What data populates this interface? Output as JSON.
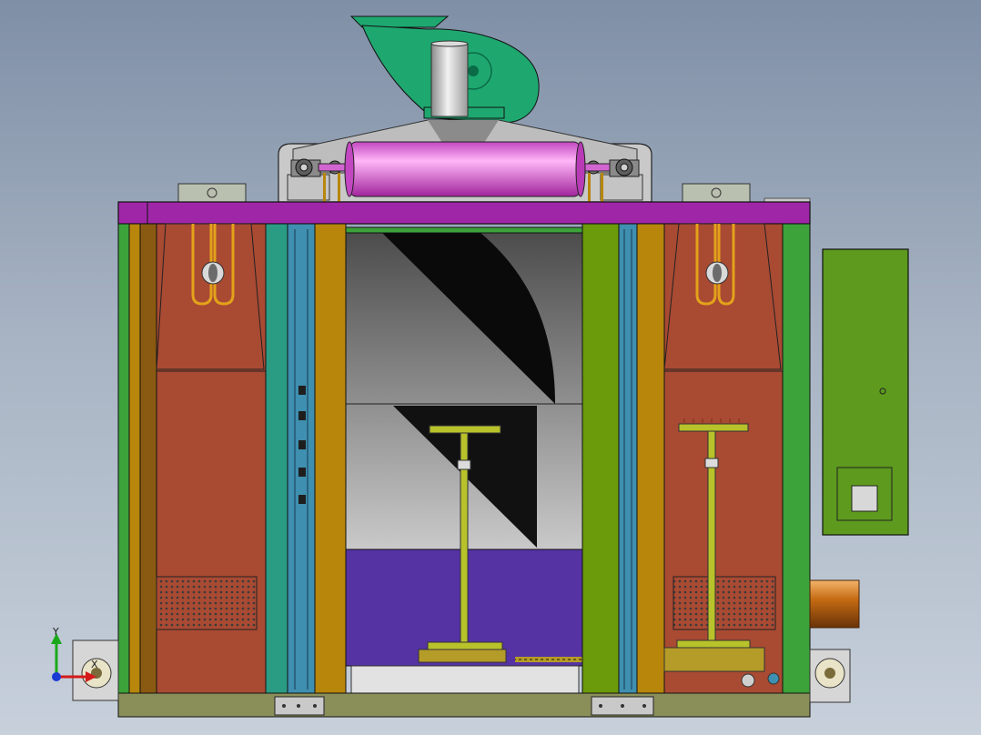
{
  "viewport": {
    "background_top": "#7f8fa6",
    "background_bottom": "#c7d0db"
  },
  "colors": {
    "frame_magenta": "#a026a8",
    "post_green": "#3ca23a",
    "post_olive": "#6b9a0a",
    "post_gold": "#b8860b",
    "panel_rust": "#a94a33",
    "teal_strip": "#2a9c84",
    "blue_strip": "#3f8fb0",
    "fan_green": "#1ea870",
    "roller_pink": "#e26ee0",
    "floor_purple": "#5533a3",
    "control_box": "#5d9a1e",
    "exhaust_copper": "#c56b14",
    "stand_yellow": "#b8c22a",
    "chamber_gray": "#a9a9a9"
  },
  "triad": {
    "y_label": "Y",
    "x_label": "X"
  },
  "icons": [
    "fan-icon",
    "bearing-icon",
    "heater-coil-icon",
    "vent-grille-icon",
    "wheel-icon",
    "axis-triad-icon"
  ]
}
